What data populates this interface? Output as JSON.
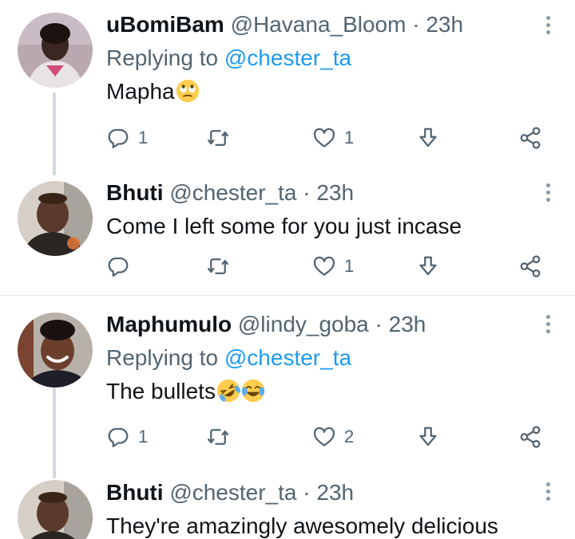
{
  "tweets": [
    {
      "name": "uBomiBam",
      "handle": "@Havana_Bloom",
      "sep": "·",
      "time": "23h",
      "replying_prefix": "Replying to",
      "replying_handle": "@chester_ta",
      "text": "Mapha",
      "emojis": [
        "face-with-rolling-eyes"
      ],
      "replies": "1",
      "retweets": "",
      "likes": "1"
    },
    {
      "name": "Bhuti",
      "handle": "@chester_ta",
      "sep": "·",
      "time": "23h",
      "text": "Come I left some for you just incase",
      "replies": "",
      "retweets": "",
      "likes": "1"
    },
    {
      "name": "Maphumulo",
      "handle": "@lindy_goba",
      "sep": "·",
      "time": "23h",
      "replying_prefix": "Replying to",
      "replying_handle": "@chester_ta",
      "text": "The bullets",
      "emojis": [
        "rolling-on-the-floor-laughing",
        "face-with-tears-of-joy"
      ],
      "replies": "1",
      "retweets": "",
      "likes": "2"
    },
    {
      "name": "Bhuti",
      "handle": "@chester_ta",
      "sep": "·",
      "time": "23h",
      "text": "They're amazingly awesomely delicious"
    }
  ],
  "colors": {
    "text": "#0f1419",
    "secondary": "#536471",
    "link": "#1d9bf0",
    "thread_line": "#cfd9de",
    "divider": "#e1e8ed"
  },
  "icons": {
    "reply": "reply-icon",
    "retweet": "retweet-icon",
    "like": "heart-icon",
    "download": "download-icon",
    "share": "share-icon",
    "more": "more-options-icon"
  }
}
